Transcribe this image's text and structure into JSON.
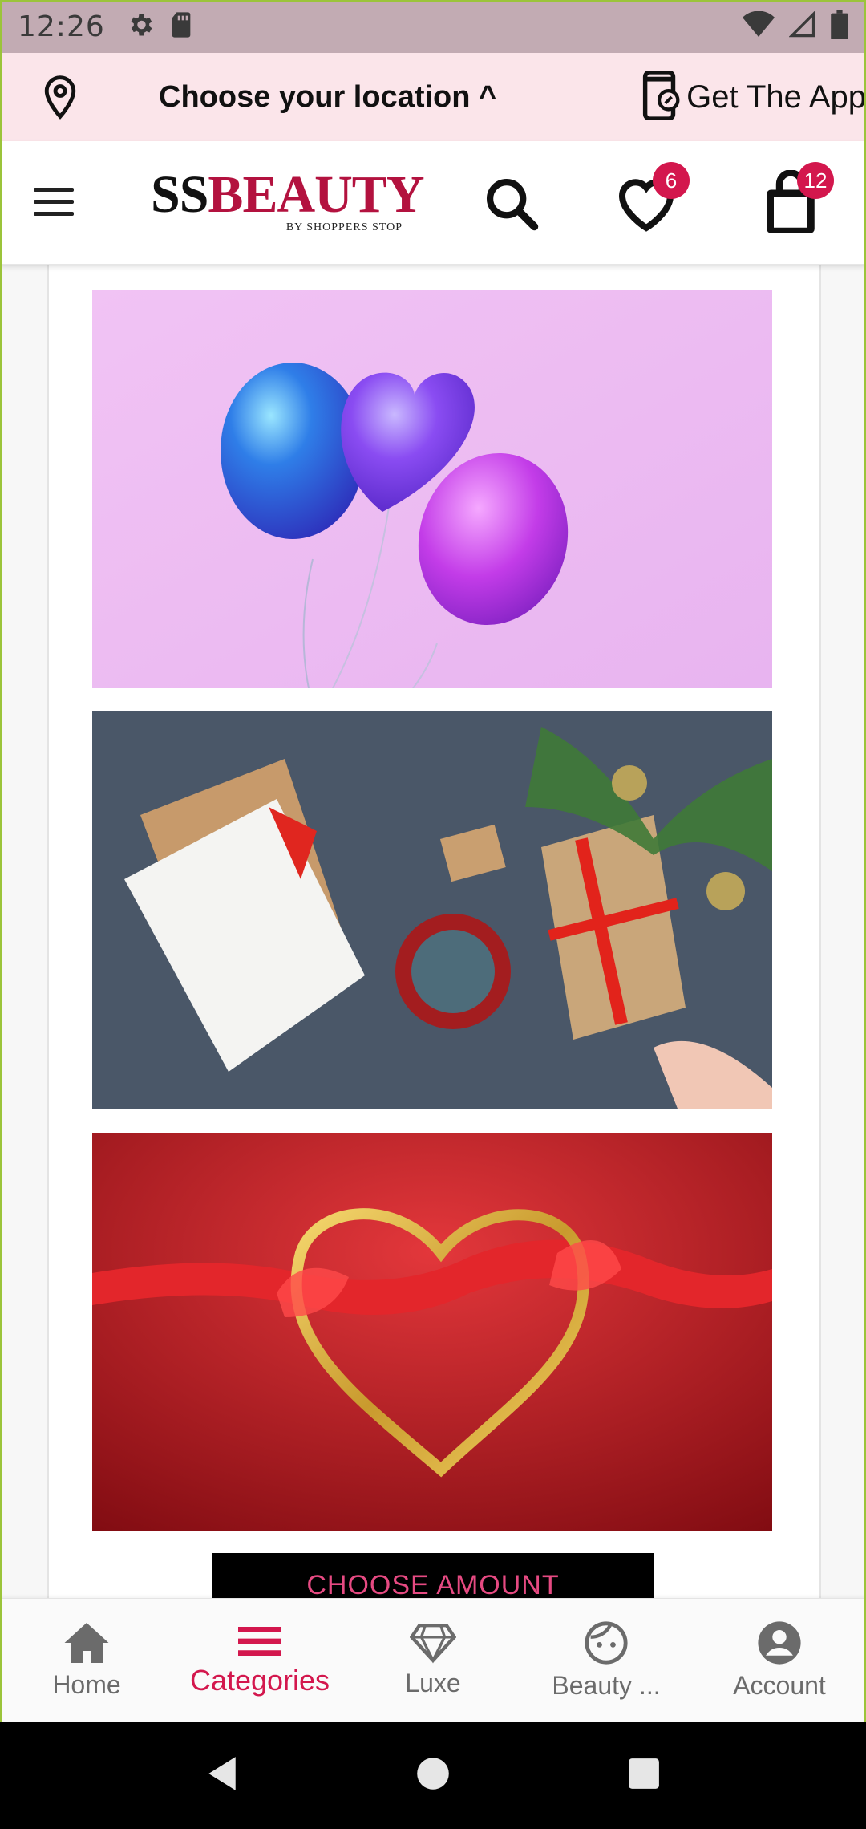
{
  "status_bar": {
    "time": "12:26",
    "icons": [
      "settings-icon",
      "sd-card-icon",
      "wifi-icon",
      "cell-signal-icon",
      "battery-icon"
    ]
  },
  "location_bar": {
    "label": "Choose your location ^",
    "get_app_label": "Get The App"
  },
  "header": {
    "logo_text_prefix": "SS",
    "logo_text_main": "BEAUTY",
    "logo_sub": "BY SHOPPERS STOP",
    "wishlist_count": "6",
    "cart_count": "12"
  },
  "cards": [
    {
      "image": "balloons-image"
    },
    {
      "image": "gift-notebook-image"
    },
    {
      "image": "red-heart-ribbon-image"
    }
  ],
  "choose_amount_label": "CHOOSE AMOUNT",
  "bottom_nav": {
    "items": [
      {
        "label": "Home",
        "icon": "home-icon"
      },
      {
        "label": "Categories",
        "icon": "menu-icon",
        "active": true
      },
      {
        "label": "Luxe",
        "icon": "diamond-icon"
      },
      {
        "label": "Beauty ...",
        "icon": "face-icon"
      },
      {
        "label": "Account",
        "icon": "account-icon"
      }
    ]
  },
  "colors": {
    "accent": "#d3174d",
    "status_bar": "#c2abb3",
    "location_bar": "#fbe5ea"
  }
}
